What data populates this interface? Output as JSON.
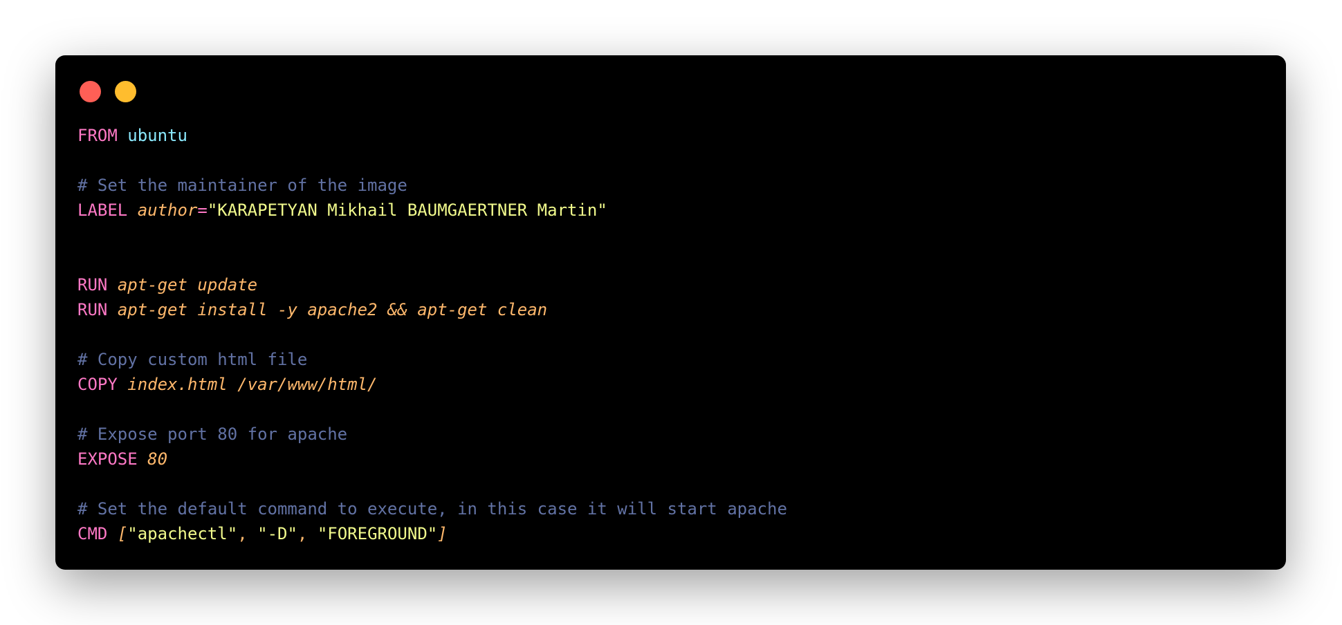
{
  "window": {
    "background": "#000000",
    "controls": [
      {
        "name": "close-control",
        "color": "#ff5f56"
      },
      {
        "name": "minimize-control",
        "color": "#ffbd2e"
      }
    ]
  },
  "colors": {
    "keyword": "#ff79c6",
    "image": "#8be9fd",
    "comment": "#6272a4",
    "attribute": "#ffb86c",
    "string": "#f1fa8c",
    "plain": "#f8f8f2"
  },
  "code_lines": [
    [
      {
        "t": "FROM",
        "c": "keyword"
      },
      {
        "t": " "
      },
      {
        "t": "ubuntu",
        "c": "image"
      }
    ],
    [],
    [
      {
        "t": "# Set the maintainer of the image",
        "c": "comment"
      }
    ],
    [
      {
        "t": "LABEL",
        "c": "keyword"
      },
      {
        "t": " "
      },
      {
        "t": "author",
        "c": "attribute",
        "i": true
      },
      {
        "t": "=",
        "c": "keyword"
      },
      {
        "t": "\"KARAPETYAN Mikhail BAUMGAERTNER Martin\"",
        "c": "string"
      }
    ],
    [],
    [],
    [
      {
        "t": "RUN",
        "c": "keyword"
      },
      {
        "t": " "
      },
      {
        "t": "apt-get update",
        "c": "attribute",
        "i": true
      }
    ],
    [
      {
        "t": "RUN",
        "c": "keyword"
      },
      {
        "t": " "
      },
      {
        "t": "apt-get install -y apache2 && apt-get clean",
        "c": "attribute",
        "i": true
      }
    ],
    [],
    [
      {
        "t": "# Copy custom html file",
        "c": "comment"
      }
    ],
    [
      {
        "t": "COPY",
        "c": "keyword"
      },
      {
        "t": " "
      },
      {
        "t": "index.html /var/www/html/",
        "c": "attribute",
        "i": true
      }
    ],
    [],
    [
      {
        "t": "# Expose port 80 for apache",
        "c": "comment"
      }
    ],
    [
      {
        "t": "EXPOSE",
        "c": "keyword"
      },
      {
        "t": " "
      },
      {
        "t": "80",
        "c": "attribute",
        "i": true
      }
    ],
    [],
    [
      {
        "t": "# Set the default command to execute, in this case it will start apache",
        "c": "comment"
      }
    ],
    [
      {
        "t": "CMD",
        "c": "keyword"
      },
      {
        "t": " "
      },
      {
        "t": "[",
        "c": "attribute",
        "i": true
      },
      {
        "t": "\"apachectl\"",
        "c": "string"
      },
      {
        "t": ", ",
        "c": "attribute"
      },
      {
        "t": "\"-D\"",
        "c": "string"
      },
      {
        "t": ", ",
        "c": "attribute"
      },
      {
        "t": "\"FOREGROUND\"",
        "c": "string"
      },
      {
        "t": "]",
        "c": "attribute",
        "i": true
      }
    ]
  ]
}
